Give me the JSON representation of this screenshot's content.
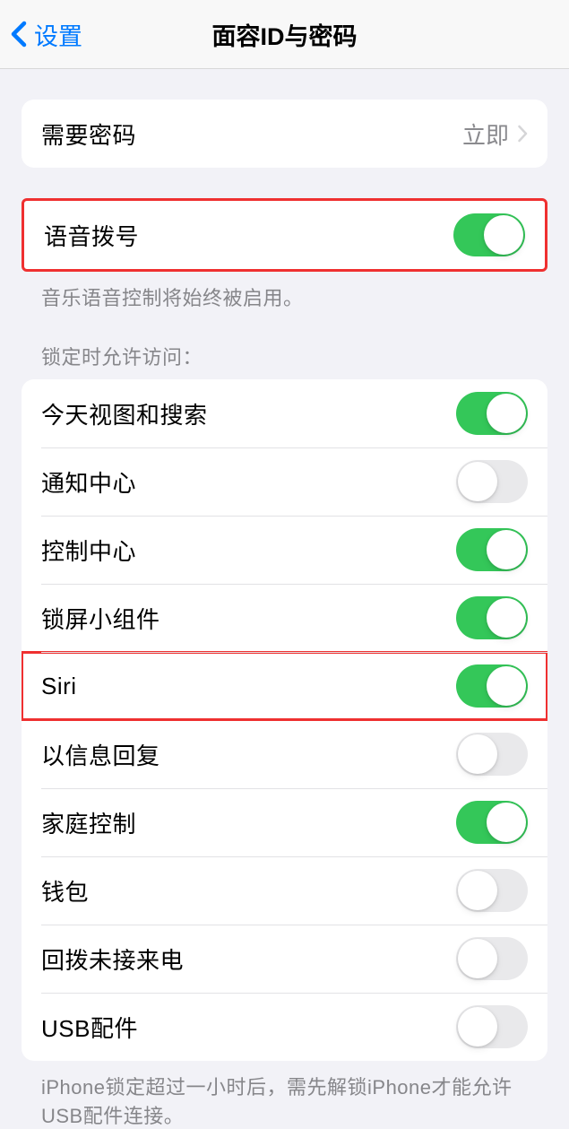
{
  "header": {
    "back_label": "设置",
    "title": "面容ID与密码"
  },
  "require_passcode": {
    "label": "需要密码",
    "value": "立即"
  },
  "voice_dial": {
    "label": "语音拨号",
    "on": true,
    "footer": "音乐语音控制将始终被启用。"
  },
  "lock_access": {
    "header": "锁定时允许访问：",
    "items": [
      {
        "label": "今天视图和搜索",
        "on": true
      },
      {
        "label": "通知中心",
        "on": false
      },
      {
        "label": "控制中心",
        "on": true
      },
      {
        "label": "锁屏小组件",
        "on": true
      },
      {
        "label": "Siri",
        "on": true,
        "highlighted": true
      },
      {
        "label": "以信息回复",
        "on": false
      },
      {
        "label": "家庭控制",
        "on": true
      },
      {
        "label": "钱包",
        "on": false
      },
      {
        "label": "回拨未接来电",
        "on": false
      },
      {
        "label": "USB配件",
        "on": false
      }
    ],
    "footer": "iPhone锁定超过一小时后，需先解锁iPhone才能允许USB配件连接。"
  }
}
